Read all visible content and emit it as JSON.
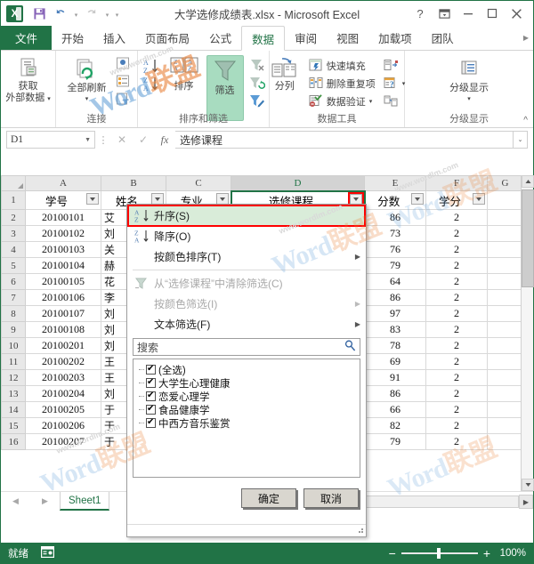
{
  "window": {
    "title": "大学选修成绩表.xlsx - Microsoft Excel",
    "help": "?",
    "ribbon_display": "ribbon-display-icon",
    "minimize": "−",
    "restore": "▭",
    "close": "✕"
  },
  "quick_access": {
    "logo": "excel-logo",
    "save": "save-icon",
    "undo": "undo-icon",
    "redo": "redo-icon",
    "customize": "customize-icon"
  },
  "tabs": [
    {
      "label": "文件",
      "active": false,
      "file": true
    },
    {
      "label": "开始",
      "active": false
    },
    {
      "label": "插入",
      "active": false
    },
    {
      "label": "页面布局",
      "active": false
    },
    {
      "label": "公式",
      "active": false
    },
    {
      "label": "数据",
      "active": true
    },
    {
      "label": "审阅",
      "active": false
    },
    {
      "label": "视图",
      "active": false
    },
    {
      "label": "加载项",
      "active": false
    },
    {
      "label": "团队",
      "active": false
    }
  ],
  "ribbon": {
    "groups": [
      {
        "title": "",
        "big": [
          {
            "label1": "获取",
            "label2": "外部数据",
            "icon": "get-external-data-icon"
          }
        ]
      },
      {
        "title": "连接",
        "big": [
          {
            "label1": "全部刷新",
            "label2": "",
            "icon": "refresh-all-icon"
          }
        ],
        "small": [
          {
            "label": "",
            "icon": "connections-icon"
          },
          {
            "label": "",
            "icon": "properties-icon"
          },
          {
            "label": "",
            "icon": "edit-links-icon"
          }
        ]
      },
      {
        "title": "排序和筛选",
        "sort_az": "sort-ascending-icon",
        "sort_za": "sort-descending-icon",
        "sort_label": "排序",
        "sort_icon": "sort-dialog-icon",
        "filter_label": "筛选",
        "filter_icon": "filter-icon",
        "small": [
          {
            "label": "",
            "icon": "clear-filter-icon"
          },
          {
            "label": "",
            "icon": "reapply-filter-icon"
          },
          {
            "label": "",
            "icon": "advanced-filter-icon"
          }
        ]
      },
      {
        "title": "数据工具",
        "text_to_columns": "分列",
        "flash_fill": "快速填充",
        "remove_duplicates": "删除重复项",
        "data_validation": "数据验证"
      },
      {
        "title": "分级显示",
        "outline_label": "分级显示"
      }
    ],
    "collapse": "^"
  },
  "formula_bar": {
    "name_box": "D1",
    "cancel": "✕",
    "enter": "✓",
    "fx": "fx",
    "content": "选修课程",
    "expand": "⌄"
  },
  "sheet": {
    "columns": [
      "A",
      "B",
      "C",
      "D",
      "E",
      "F",
      "G"
    ],
    "selected_column": "D",
    "headers": [
      "学号",
      "姓名",
      "专业",
      "选修课程",
      "分数",
      "学分"
    ],
    "rows": [
      {
        "n": "1",
        "a": "学号",
        "b": "姓名",
        "c": "专业",
        "d": "选修课程",
        "e": "分数",
        "f": "学分"
      },
      {
        "n": "2",
        "a": "20100101",
        "b": "艾",
        "c": "",
        "d": "",
        "e": "86",
        "f": "2"
      },
      {
        "n": "3",
        "a": "20100102",
        "b": "刘",
        "c": "",
        "d": "",
        "e": "73",
        "f": "2"
      },
      {
        "n": "4",
        "a": "20100103",
        "b": "关",
        "c": "",
        "d": "",
        "e": "76",
        "f": "2"
      },
      {
        "n": "5",
        "a": "20100104",
        "b": "赫",
        "c": "",
        "d": "",
        "e": "79",
        "f": "2"
      },
      {
        "n": "6",
        "a": "20100105",
        "b": "花",
        "c": "",
        "d": "",
        "e": "64",
        "f": "2"
      },
      {
        "n": "7",
        "a": "20100106",
        "b": "李",
        "c": "",
        "d": "",
        "e": "86",
        "f": "2"
      },
      {
        "n": "8",
        "a": "20100107",
        "b": "刘",
        "c": "",
        "d": "",
        "e": "97",
        "f": "2"
      },
      {
        "n": "9",
        "a": "20100108",
        "b": "刘",
        "c": "",
        "d": "",
        "e": "83",
        "f": "2"
      },
      {
        "n": "10",
        "a": "20100201",
        "b": "刘",
        "c": "",
        "d": "",
        "e": "78",
        "f": "2"
      },
      {
        "n": "11",
        "a": "20100202",
        "b": "王",
        "c": "",
        "d": "",
        "e": "69",
        "f": "2"
      },
      {
        "n": "12",
        "a": "20100203",
        "b": "王",
        "c": "",
        "d": "",
        "e": "91",
        "f": "2"
      },
      {
        "n": "13",
        "a": "20100204",
        "b": "刘",
        "c": "",
        "d": "",
        "e": "86",
        "f": "2"
      },
      {
        "n": "14",
        "a": "20100205",
        "b": "于",
        "c": "",
        "d": "",
        "e": "66",
        "f": "2"
      },
      {
        "n": "15",
        "a": "20100206",
        "b": "于",
        "c": "",
        "d": "",
        "e": "82",
        "f": "2"
      },
      {
        "n": "16",
        "a": "20100207",
        "b": "于",
        "c": "",
        "d": "",
        "e": "79",
        "f": "2"
      }
    ],
    "tab_name": "Sheet1",
    "nav_first": "◀",
    "nav_last": "▶"
  },
  "filter_menu": {
    "items": [
      {
        "label": "升序(S)",
        "icon": "sort-ascending-icon",
        "highlighted": true,
        "disabled": false,
        "submenu": false
      },
      {
        "label": "降序(O)",
        "icon": "sort-descending-icon",
        "highlighted": false,
        "disabled": false,
        "submenu": false
      },
      {
        "label": "按颜色排序(T)",
        "icon": "",
        "highlighted": false,
        "disabled": false,
        "submenu": true
      },
      {
        "label": "从“选修课程”中清除筛选(C)",
        "icon": "clear-filter-icon",
        "highlighted": false,
        "disabled": true,
        "submenu": false
      },
      {
        "label": "按颜色筛选(I)",
        "icon": "",
        "highlighted": false,
        "disabled": true,
        "submenu": true
      },
      {
        "label": "文本筛选(F)",
        "icon": "",
        "highlighted": false,
        "disabled": false,
        "submenu": true
      }
    ],
    "search_placeholder": "搜索",
    "search_icon": "search-icon",
    "checklist": [
      {
        "label": "(全选)",
        "checked": true
      },
      {
        "label": "大学生心理健康",
        "checked": true
      },
      {
        "label": "恋爱心理学",
        "checked": true
      },
      {
        "label": "食品健康学",
        "checked": true
      },
      {
        "label": "中西方音乐鉴赏",
        "checked": true
      }
    ],
    "ok": "确定",
    "cancel": "取消"
  },
  "status_bar": {
    "mode": "就绪",
    "view_icon": "page-layout-icon",
    "zoom_out": "−",
    "zoom_in": "+",
    "zoom_level": "100%"
  },
  "watermark": {
    "word": "Word",
    "cn": "联盟",
    "url": "www.wordlm.com"
  },
  "colors": {
    "accent": "#217346",
    "filter_active": "#a8dcc0",
    "highlight": "#d9ecd9",
    "red_box": "#ff0000"
  }
}
